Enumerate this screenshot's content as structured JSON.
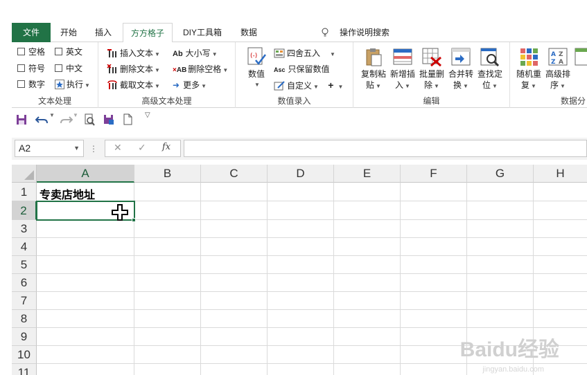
{
  "tabs": [
    {
      "label": "文件",
      "type": "file"
    },
    {
      "label": "开始",
      "type": "normal"
    },
    {
      "label": "插入",
      "type": "normal"
    },
    {
      "label": "方方格子",
      "type": "active"
    },
    {
      "label": "DIY工具箱",
      "type": "normal"
    },
    {
      "label": "数据",
      "type": "normal"
    }
  ],
  "tell_me": "操作说明搜索",
  "ribbon": {
    "text_processing": {
      "label": "文本处理",
      "options": [
        "空格",
        "英文",
        "符号",
        "中文",
        "数字"
      ],
      "execute": "执行"
    },
    "advanced_text": {
      "label": "高级文本处理",
      "commands": [
        "插入文本",
        "删除文本",
        "截取文本",
        "大小写",
        "删除空格",
        "更多"
      ]
    },
    "numeric_entry": {
      "label": "数值录入",
      "value_button": "数值",
      "commands": [
        "四舍五入",
        "只保留数值",
        "自定义"
      ]
    },
    "edit": {
      "label": "编辑",
      "buttons": [
        {
          "line1": "复制粘",
          "line2": "贴"
        },
        {
          "line1": "新增插",
          "line2": "入"
        },
        {
          "line1": "批量删",
          "line2": "除"
        },
        {
          "line1": "合并转",
          "line2": "换"
        },
        {
          "line1": "查找定",
          "line2": "位"
        }
      ]
    },
    "data_analysis": {
      "label": "数据分",
      "buttons": [
        {
          "line1": "随机重",
          "line2": "复"
        },
        {
          "line1": "高级排",
          "line2": "序"
        }
      ]
    }
  },
  "formula_bar": {
    "name_box": "A2",
    "fx": "fx",
    "content": ""
  },
  "grid": {
    "columns": [
      "A",
      "B",
      "C",
      "D",
      "E",
      "F",
      "G",
      "H"
    ],
    "rows": [
      "1",
      "2",
      "3",
      "4",
      "5",
      "6",
      "7",
      "8",
      "9",
      "10",
      "11"
    ],
    "cells": {
      "A1": "专卖店地址"
    },
    "selected": "A2"
  },
  "watermark": {
    "brand": "Baidu经验",
    "url": "jingyan.baidu.com"
  },
  "colors": {
    "accent": "#217346"
  }
}
